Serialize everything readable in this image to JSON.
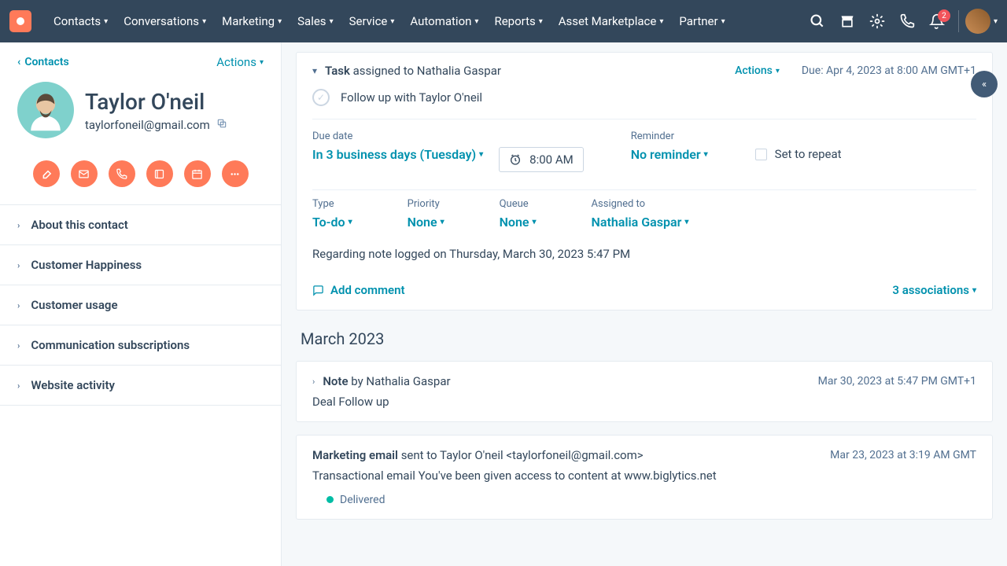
{
  "nav": {
    "items": [
      "Contacts",
      "Conversations",
      "Marketing",
      "Sales",
      "Service",
      "Automation",
      "Reports",
      "Asset Marketplace",
      "Partner"
    ],
    "notif_count": "2"
  },
  "sidebar": {
    "back_label": "Contacts",
    "actions_label": "Actions",
    "contact_name": "Taylor O'neil",
    "contact_email": "taylorfoneil@gmail.com",
    "sections": [
      "About this contact",
      "Customer Happiness",
      "Customer usage",
      "Communication subscriptions",
      "Website activity"
    ]
  },
  "task": {
    "header_label": "Task",
    "header_assigned": "assigned to Nathalia Gaspar",
    "actions_label": "Actions",
    "due_text": "Due: Apr 4, 2023 at 8:00 AM GMT+1",
    "title": "Follow up with Taylor O'neil",
    "due_date_label": "Due date",
    "due_date_value": "In 3 business days (Tuesday)",
    "due_time_value": "8:00 AM",
    "reminder_label": "Reminder",
    "reminder_value": "No reminder",
    "repeat_label": "Set to repeat",
    "type_label": "Type",
    "type_value": "To-do",
    "priority_label": "Priority",
    "priority_value": "None",
    "queue_label": "Queue",
    "queue_value": "None",
    "assigned_label": "Assigned to",
    "assigned_value": "Nathalia Gaspar",
    "note_line": "Regarding note logged on Thursday, March 30, 2023 5:47 PM",
    "add_comment": "Add comment",
    "associations": "3 associations"
  },
  "timeline": {
    "month_label": "March 2023",
    "note": {
      "type": "Note",
      "by": "by Nathalia Gaspar",
      "ts": "Mar 30, 2023 at 5:47 PM GMT+1",
      "body": "Deal Follow up"
    },
    "email": {
      "type": "Marketing email",
      "to": "sent to Taylor O'neil <taylorfoneil@gmail.com>",
      "ts": "Mar 23, 2023 at 3:19 AM GMT",
      "body": "Transactional email You've been given access to content at www.biglytics.net",
      "status": "Delivered"
    }
  }
}
